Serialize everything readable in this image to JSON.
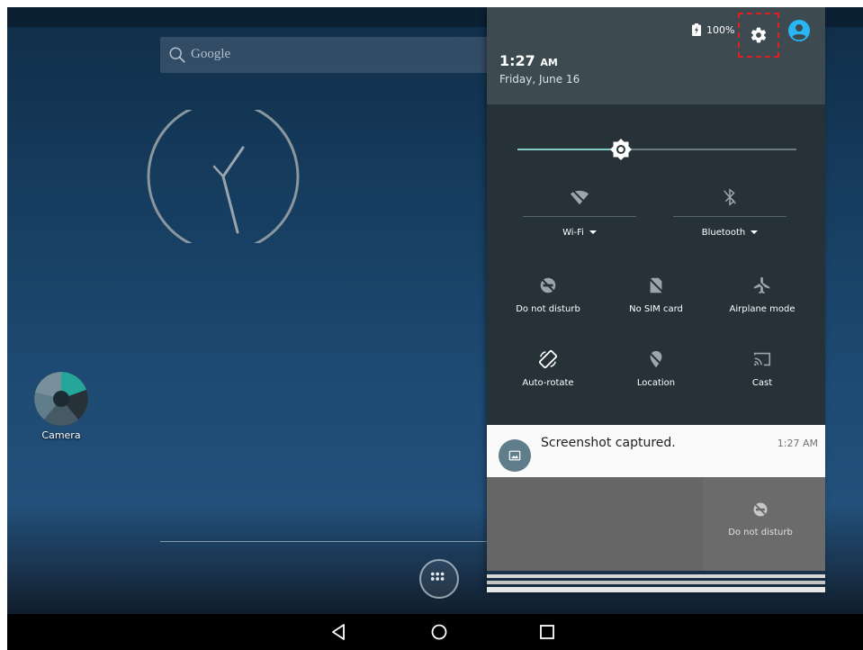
{
  "home": {
    "search_label": "Google",
    "camera_label": "Camera"
  },
  "status": {
    "battery": "100%"
  },
  "header": {
    "time": "1:27",
    "ampm": "AM",
    "date": "Friday, June 16"
  },
  "quick_settings": {
    "brightness_level": 0.37,
    "wifi_label": "Wi-Fi",
    "bluetooth_label": "Bluetooth",
    "tiles": [
      {
        "label": "Do not disturb",
        "icon": "do-not-disturb-icon"
      },
      {
        "label": "No SIM card",
        "icon": "no-sim-icon"
      },
      {
        "label": "Airplane mode",
        "icon": "airplane-icon"
      },
      {
        "label": "Auto-rotate",
        "icon": "auto-rotate-icon"
      },
      {
        "label": "Location",
        "icon": "location-off-icon"
      },
      {
        "label": "Cast",
        "icon": "cast-icon"
      }
    ]
  },
  "notification": {
    "title": "Screenshot captured.",
    "time": "1:27 AM"
  },
  "ghost_tile": {
    "label": "Do not disturb"
  },
  "colors": {
    "shade_header": "#3d4a50",
    "qs_background": "#263238",
    "accent": "#80cbc4",
    "user_icon": "#29b6f6",
    "highlight_box": "#e02020"
  }
}
